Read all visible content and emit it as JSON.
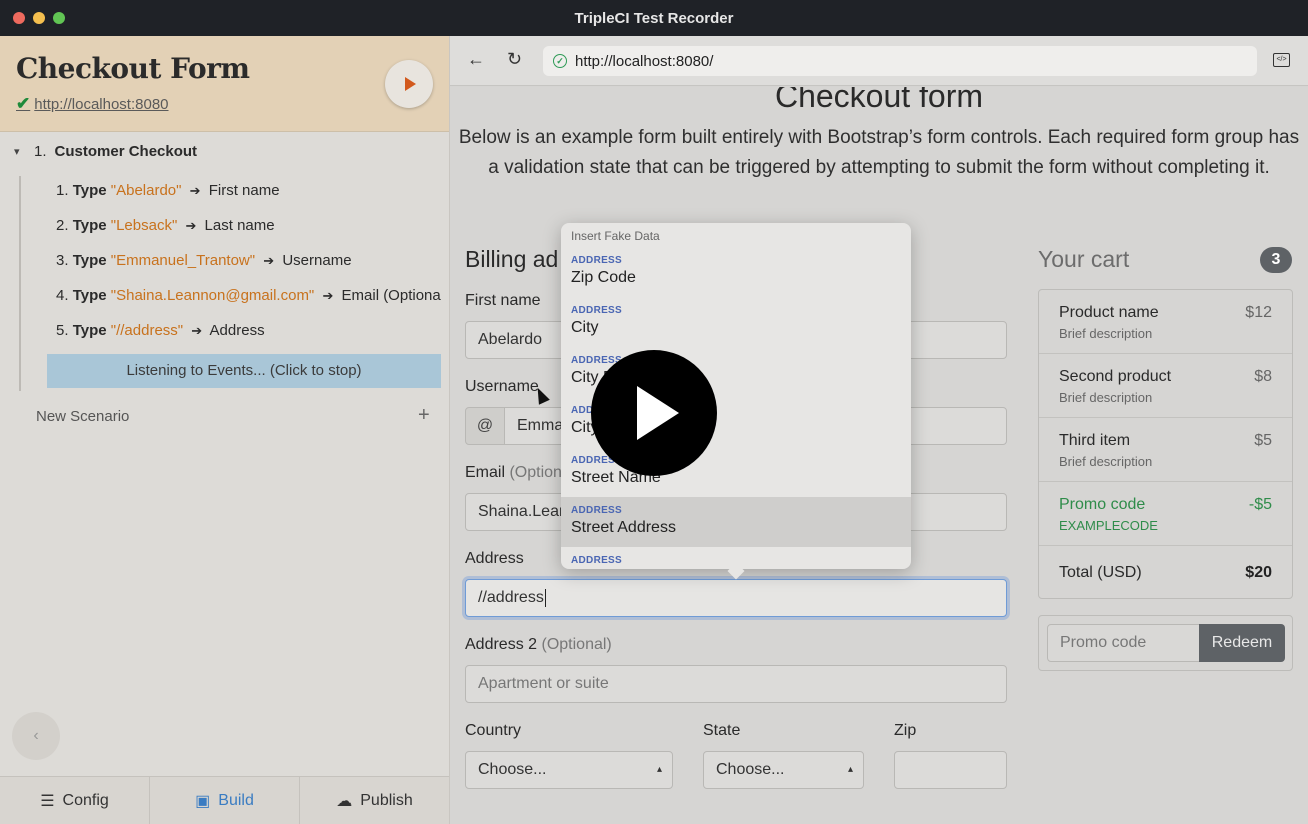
{
  "window": {
    "title": "TripleCI Test Recorder"
  },
  "recorder": {
    "title": "Checkout Form",
    "url": "http://localhost:8080",
    "scenario_number": "1.",
    "scenario_name": "Customer Checkout",
    "steps": [
      {
        "num": "1.",
        "action": "Type",
        "value": "\"Abelardo\"",
        "target": "First name"
      },
      {
        "num": "2.",
        "action": "Type",
        "value": "\"Lebsack\"",
        "target": "Last name"
      },
      {
        "num": "3.",
        "action": "Type",
        "value": "\"Emmanuel_Trantow\"",
        "target": "Username"
      },
      {
        "num": "4.",
        "action": "Type",
        "value": "\"Shaina.Leannon@gmail.com\"",
        "target": "Email (Optional)"
      },
      {
        "num": "5.",
        "action": "Type",
        "value": "\"//address\"",
        "target": "Address"
      }
    ],
    "listening": "Listening to Events... (Click to stop)",
    "new_scenario": "New Scenario",
    "tabs": {
      "config": "Config",
      "build": "Build",
      "publish": "Publish"
    },
    "active_tab": "build"
  },
  "browser": {
    "url": "http://localhost:8080/"
  },
  "page": {
    "heading": "Checkout form",
    "lead": "Below is an example form built entirely with Bootstrap’s form controls. Each required form group has a validation state that can be triggered by attempting to submit the form without completing it.",
    "billing_title": "Billing ad",
    "first_name_label": "First name",
    "first_name_value": "Abelardo",
    "username_label": "Username",
    "username_addon": "@",
    "username_value": "Emma",
    "email_label": "Email",
    "email_optional": "(Option",
    "email_value": "Shaina.Lean",
    "address_label": "Address",
    "address_value": "//address",
    "address2_label": "Address 2",
    "address2_optional": "(Optional)",
    "address2_placeholder": "Apartment or suite",
    "country_label": "Country",
    "country_value": "Choose...",
    "state_label": "State",
    "state_value": "Choose...",
    "zip_label": "Zip"
  },
  "cart": {
    "title": "Your cart",
    "count": "3",
    "items": [
      {
        "name": "Product name",
        "desc": "Brief description",
        "price": "$12"
      },
      {
        "name": "Second product",
        "desc": "Brief description",
        "price": "$8"
      },
      {
        "name": "Third item",
        "desc": "Brief description",
        "price": "$5"
      }
    ],
    "promo": {
      "name": "Promo code",
      "code": "EXAMPLECODE",
      "amount": "-$5"
    },
    "total_label": "Total (USD)",
    "total_value": "$20",
    "promo_placeholder": "Promo code",
    "redeem": "Redeem"
  },
  "fake_data_popup": {
    "header": "Insert Fake Data",
    "items": [
      {
        "category": "ADDRESS",
        "name": "Zip Code"
      },
      {
        "category": "ADDRESS",
        "name": "City"
      },
      {
        "category": "ADDRESS",
        "name": "City Prefix"
      },
      {
        "category": "ADDRESS",
        "name": "City Suffix"
      },
      {
        "category": "ADDRESS",
        "name": "Street Name"
      },
      {
        "category": "ADDRESS",
        "name": "Street Address"
      },
      {
        "category": "ADDRESS",
        "name": ""
      }
    ],
    "selected_index": 5
  },
  "colors": {
    "accent_orange": "#c8721d",
    "success_green": "#2f8c4a",
    "active_blue": "#3a7cc2"
  }
}
